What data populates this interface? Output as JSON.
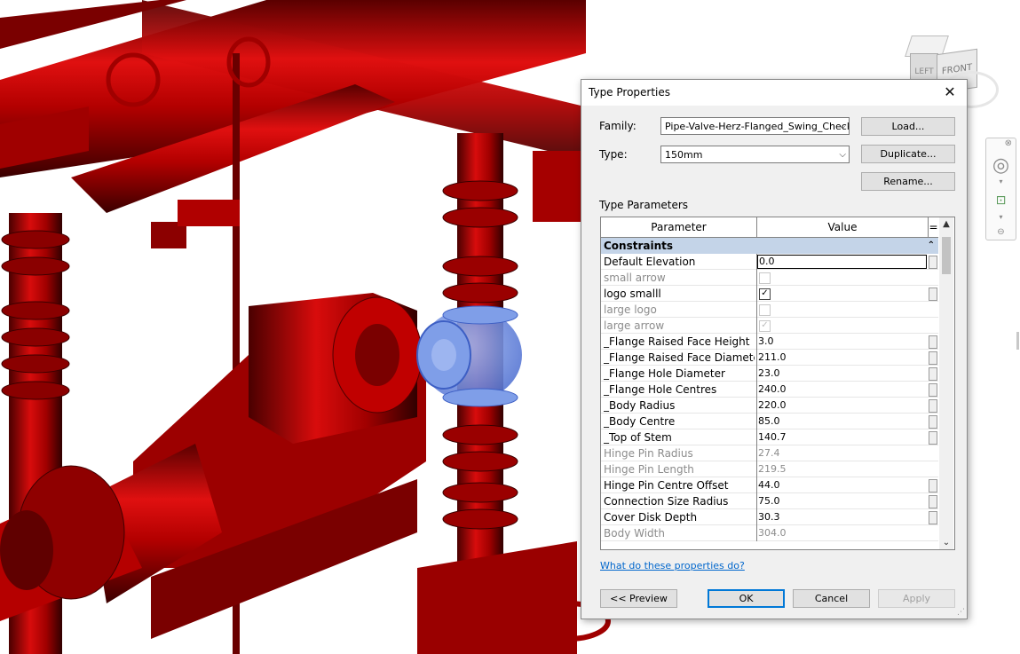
{
  "dialog": {
    "title": "Type Properties",
    "family_label": "Family:",
    "family_value": "Pipe-Valve-Herz-Flanged_Swing_Check_",
    "type_label": "Type:",
    "type_value": "150mm",
    "buttons": {
      "load": "Load...",
      "duplicate": "Duplicate...",
      "rename": "Rename..."
    },
    "type_parameters_label": "Type Parameters",
    "grid": {
      "col_parameter": "Parameter",
      "col_value": "Value",
      "col_eq": "=",
      "group": "Constraints",
      "rows": [
        {
          "name": "Default Elevation",
          "value": "0.0",
          "kind": "edit",
          "dim": false
        },
        {
          "name": "small arrow",
          "value": "",
          "kind": "check",
          "checked": false,
          "dim": true
        },
        {
          "name": "logo smalll",
          "value": "",
          "kind": "check",
          "checked": true,
          "dim": false
        },
        {
          "name": "large logo",
          "value": "",
          "kind": "check",
          "checked": false,
          "dim": true
        },
        {
          "name": "large arrow",
          "value": "",
          "kind": "check",
          "checked": true,
          "dim": true
        },
        {
          "name": "_Flange Raised Face Height",
          "value": "3.0",
          "kind": "text",
          "dim": false
        },
        {
          "name": "_Flange Raised Face Diameter",
          "value": "211.0",
          "kind": "text",
          "dim": false
        },
        {
          "name": "_Flange Hole Diameter",
          "value": "23.0",
          "kind": "text",
          "dim": false
        },
        {
          "name": "_Flange Hole Centres",
          "value": "240.0",
          "kind": "text",
          "dim": false
        },
        {
          "name": "_Body Radius",
          "value": "220.0",
          "kind": "text",
          "dim": false
        },
        {
          "name": "_Body Centre",
          "value": "85.0",
          "kind": "text",
          "dim": false
        },
        {
          "name": "_Top of Stem",
          "value": "140.7",
          "kind": "text",
          "dim": false
        },
        {
          "name": "Hinge Pin Radius",
          "value": "27.4",
          "kind": "text",
          "dim": true
        },
        {
          "name": "Hinge Pin Length",
          "value": "219.5",
          "kind": "text",
          "dim": true
        },
        {
          "name": "Hinge Pin Centre Offset",
          "value": "44.0",
          "kind": "text",
          "dim": false
        },
        {
          "name": "Connection Size Radius",
          "value": "75.0",
          "kind": "text",
          "dim": false
        },
        {
          "name": "Cover Disk Depth",
          "value": "30.3",
          "kind": "text",
          "dim": false
        },
        {
          "name": "Body Width",
          "value": "304.0",
          "kind": "text",
          "dim": true
        }
      ]
    },
    "help_link": "What do these properties do?",
    "footer": {
      "preview": "<< Preview",
      "ok": "OK",
      "cancel": "Cancel",
      "apply": "Apply"
    }
  },
  "viewcube": {
    "left_label": "LEFT",
    "front_label": "FRONT"
  },
  "colors": {
    "pipe_red": "#b00000",
    "selection_blue": "#6a8fe8",
    "group_header": "#c4d4e8"
  }
}
